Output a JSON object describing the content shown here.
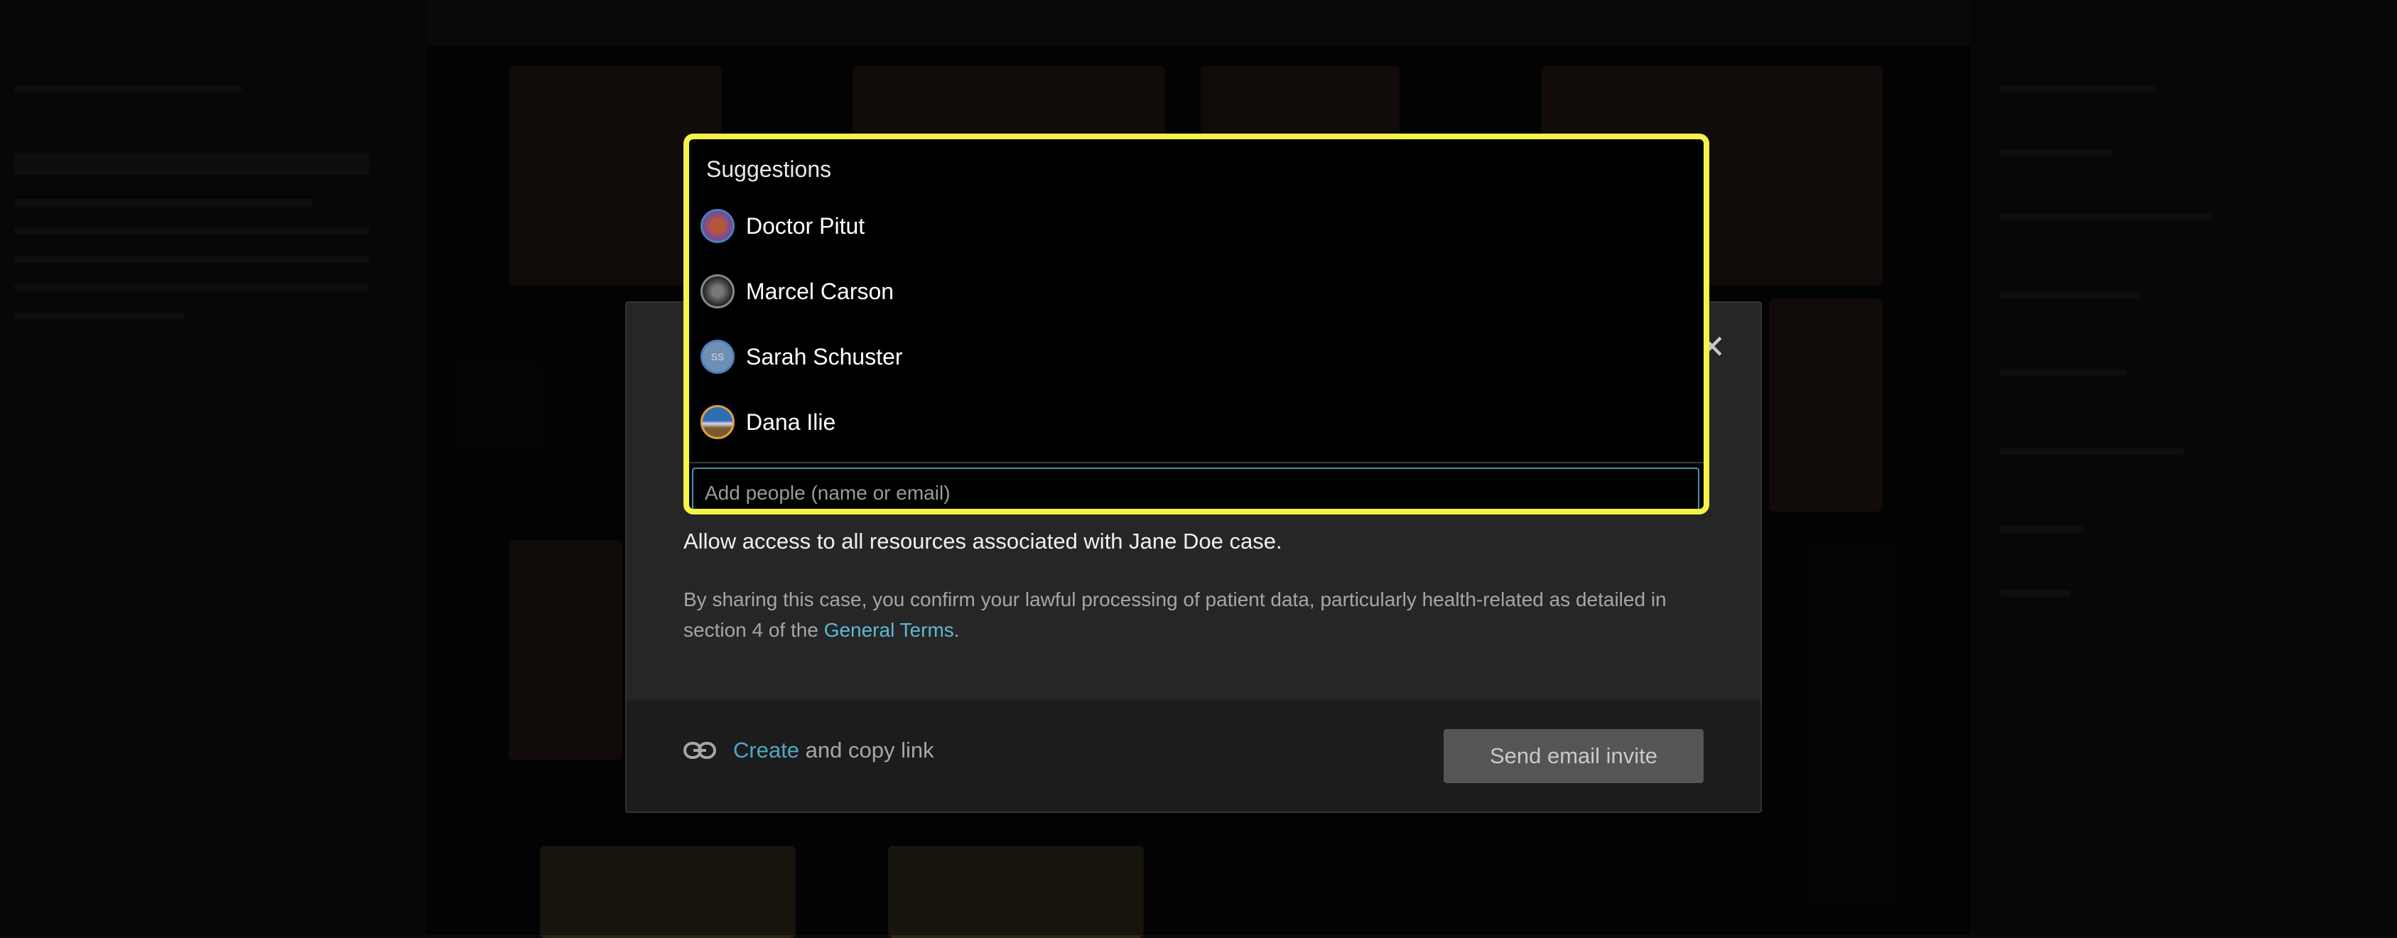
{
  "dialog": {
    "close_icon": "close-icon",
    "allow_text": "Allow access to all resources associated with Jane Doe case.",
    "legal_prefix": "By sharing this case, you confirm your lawful processing of patient data, particularly health-related as detailed in section 4 of the",
    "legal_link": "General Terms",
    "legal_suffix": ".",
    "footer": {
      "link_icon": "link-icon",
      "create_label": "Create",
      "copy_label": "and copy link",
      "send_button": "Send email invite"
    }
  },
  "suggestions": {
    "title": "Suggestions",
    "items": [
      {
        "name": "Doctor Pitut",
        "avatar": "photo"
      },
      {
        "name": "Marcel Carson",
        "avatar": "photo"
      },
      {
        "name": "Sarah Schuster",
        "avatar": "SS"
      },
      {
        "name": "Dana Ilie",
        "avatar": "photo"
      }
    ],
    "input_placeholder": "Add people (name or email)",
    "input_value": ""
  },
  "colors": {
    "highlight": "#f3f34a",
    "link": "#5fb8d6",
    "button_bg": "#555555"
  }
}
